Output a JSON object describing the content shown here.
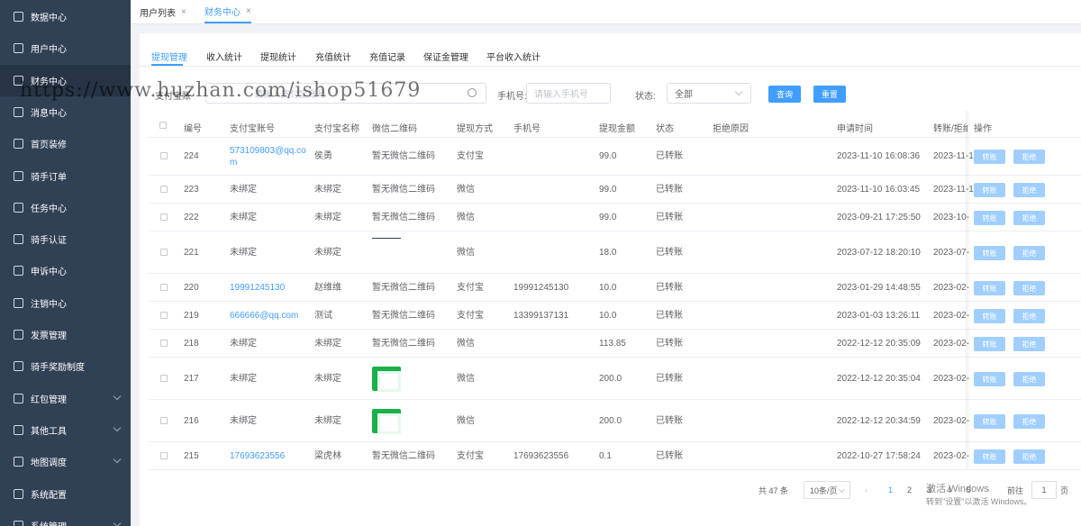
{
  "sidebar": {
    "items": [
      {
        "label": "数据中心",
        "icon": "chart-icon",
        "chevron": false
      },
      {
        "label": "用户中心",
        "icon": "user-icon",
        "chevron": false
      },
      {
        "label": "财务中心",
        "icon": "wallet-icon",
        "chevron": false,
        "active": true
      },
      {
        "label": "消息中心",
        "icon": "message-icon",
        "chevron": false
      },
      {
        "label": "首页装修",
        "icon": "cube-icon",
        "chevron": false
      },
      {
        "label": "骑手订单",
        "icon": "document-icon",
        "chevron": false
      },
      {
        "label": "任务中心",
        "icon": "clipboard-icon",
        "chevron": false
      },
      {
        "label": "骑手认证",
        "icon": "cube-icon",
        "chevron": false
      },
      {
        "label": "申诉中心",
        "icon": "user-icon",
        "chevron": false
      },
      {
        "label": "注销中心",
        "icon": "clipboard-icon",
        "chevron": false
      },
      {
        "label": "发票管理",
        "icon": "cloud-upload-icon",
        "chevron": false
      },
      {
        "label": "骑手奖励制度",
        "icon": "document-icon",
        "chevron": false
      },
      {
        "label": "红包管理",
        "icon": "red-packet-icon",
        "chevron": true
      },
      {
        "label": "其他工具",
        "icon": "toolbox-icon",
        "chevron": true
      },
      {
        "label": "地图调度",
        "icon": "location-icon",
        "chevron": true
      },
      {
        "label": "系统配置",
        "icon": "list-icon",
        "chevron": false
      },
      {
        "label": "系统管理",
        "icon": "gear-icon",
        "chevron": true
      }
    ]
  },
  "page_tabs": [
    {
      "label": "用户列表",
      "close": "×"
    },
    {
      "label": "财务中心",
      "close": "×",
      "active": true
    }
  ],
  "sub_tabs": [
    "提现管理",
    "收入统计",
    "提现统计",
    "充值统计",
    "充值记录",
    "保证金管理",
    "平台收入统计"
  ],
  "filters": {
    "alipay_label": "支付宝账",
    "alipay_placeholder": "请输入支付宝账号",
    "phone_label": "手机号:",
    "phone_placeholder": "请输入手机号",
    "status_label": "状态:",
    "status_value": "全部",
    "search_button": "查询",
    "reset_button": "重置"
  },
  "table": {
    "headers": [
      "编号",
      "支付宝账号",
      "支付宝名称",
      "微信二维码",
      "提现方式",
      "手机号",
      "提现金额",
      "状态",
      "拒绝原因",
      "申请时间",
      "转账/拒绝",
      "操作"
    ],
    "action_transfer": "转账",
    "action_reject": "拒绝",
    "rows": [
      {
        "id": "224",
        "account": "573109803@qq.com",
        "account_line1": "573109803@qq.co",
        "account_line2": "m",
        "account_link": true,
        "name": "侯勇",
        "qr": "暂无微信二维码",
        "qr_type": "text",
        "method": "支付宝",
        "phone": "",
        "amount": "99.0",
        "status": "已转账",
        "reason": "",
        "apply_time": "2023-11-10 16:08:36",
        "handle_time": "2023-11-1"
      },
      {
        "id": "223",
        "account": "未绑定",
        "account_link": false,
        "name": "未绑定",
        "qr": "暂无微信二维码",
        "qr_type": "text",
        "method": "微信",
        "phone": "",
        "amount": "99.0",
        "status": "已转账",
        "reason": "",
        "apply_time": "2023-11-10 16:03:45",
        "handle_time": "2023-11-1"
      },
      {
        "id": "222",
        "account": "未绑定",
        "account_link": false,
        "name": "未绑定",
        "qr": "暂无微信二维码",
        "qr_type": "text",
        "method": "微信",
        "phone": "",
        "amount": "99.0",
        "status": "已转账",
        "reason": "",
        "apply_time": "2023-09-21 17:25:50",
        "handle_time": "2023-10-"
      },
      {
        "id": "221",
        "account": "未绑定",
        "account_link": false,
        "name": "未绑定",
        "qr": "",
        "qr_type": "line",
        "method": "微信",
        "phone": "",
        "amount": "18.0",
        "status": "已转账",
        "reason": "",
        "apply_time": "2023-07-12 18:20:10",
        "handle_time": "2023-07-"
      },
      {
        "id": "220",
        "account": "19991245130",
        "account_link": true,
        "name": "赵维维",
        "qr": "暂无微信二维码",
        "qr_type": "text",
        "method": "支付宝",
        "phone": "19991245130",
        "amount": "10.0",
        "status": "已转账",
        "reason": "",
        "apply_time": "2023-01-29 14:48:55",
        "handle_time": "2023-02-"
      },
      {
        "id": "219",
        "account": "666666@qq.com",
        "account_link": true,
        "name": "测试",
        "qr": "暂无微信二维码",
        "qr_type": "text",
        "method": "支付宝",
        "phone": "13399137131",
        "amount": "10.0",
        "status": "已转账",
        "reason": "",
        "apply_time": "2023-01-03 13:26:11",
        "handle_time": "2023-02-"
      },
      {
        "id": "218",
        "account": "未绑定",
        "account_link": false,
        "name": "未绑定",
        "qr": "暂无微信二维码",
        "qr_type": "text",
        "method": "微信",
        "phone": "",
        "amount": "113.85",
        "status": "已转账",
        "reason": "",
        "apply_time": "2022-12-12 20:35:09",
        "handle_time": "2023-02-"
      },
      {
        "id": "217",
        "account": "未绑定",
        "account_link": false,
        "name": "未绑定",
        "qr": "",
        "qr_type": "image",
        "method": "微信",
        "phone": "",
        "amount": "200.0",
        "status": "已转账",
        "reason": "",
        "apply_time": "2022-12-12 20:35:04",
        "handle_time": "2023-02-"
      },
      {
        "id": "216",
        "account": "未绑定",
        "account_link": false,
        "name": "未绑定",
        "qr": "",
        "qr_type": "image",
        "method": "微信",
        "phone": "",
        "amount": "200.0",
        "status": "已转账",
        "reason": "",
        "apply_time": "2022-12-12 20:34:59",
        "handle_time": "2023-02-"
      },
      {
        "id": "215",
        "account": "17693623556",
        "account_link": true,
        "name": "梁虎林",
        "qr": "暂无微信二维码",
        "qr_type": "text",
        "method": "支付宝",
        "phone": "17693623556",
        "amount": "0.1",
        "status": "已转账",
        "reason": "",
        "apply_time": "2022-10-27 17:58:24",
        "handle_time": "2023-02-"
      }
    ]
  },
  "pagination": {
    "total": "共 47 条",
    "page_size": "10条/页",
    "prev": "‹",
    "pages": [
      "1",
      "2",
      "3",
      "4",
      "5"
    ],
    "current_page": "1",
    "next": "›",
    "goto_label": "前往",
    "goto_value": "1",
    "goto_suffix": "页"
  },
  "overlay": {
    "watermark": "https://www.huzhan.com/ishop51679",
    "activate_windows_title": "激活 Windows",
    "activate_windows_sub": "转到\"设置\"以激活 Windows。"
  }
}
